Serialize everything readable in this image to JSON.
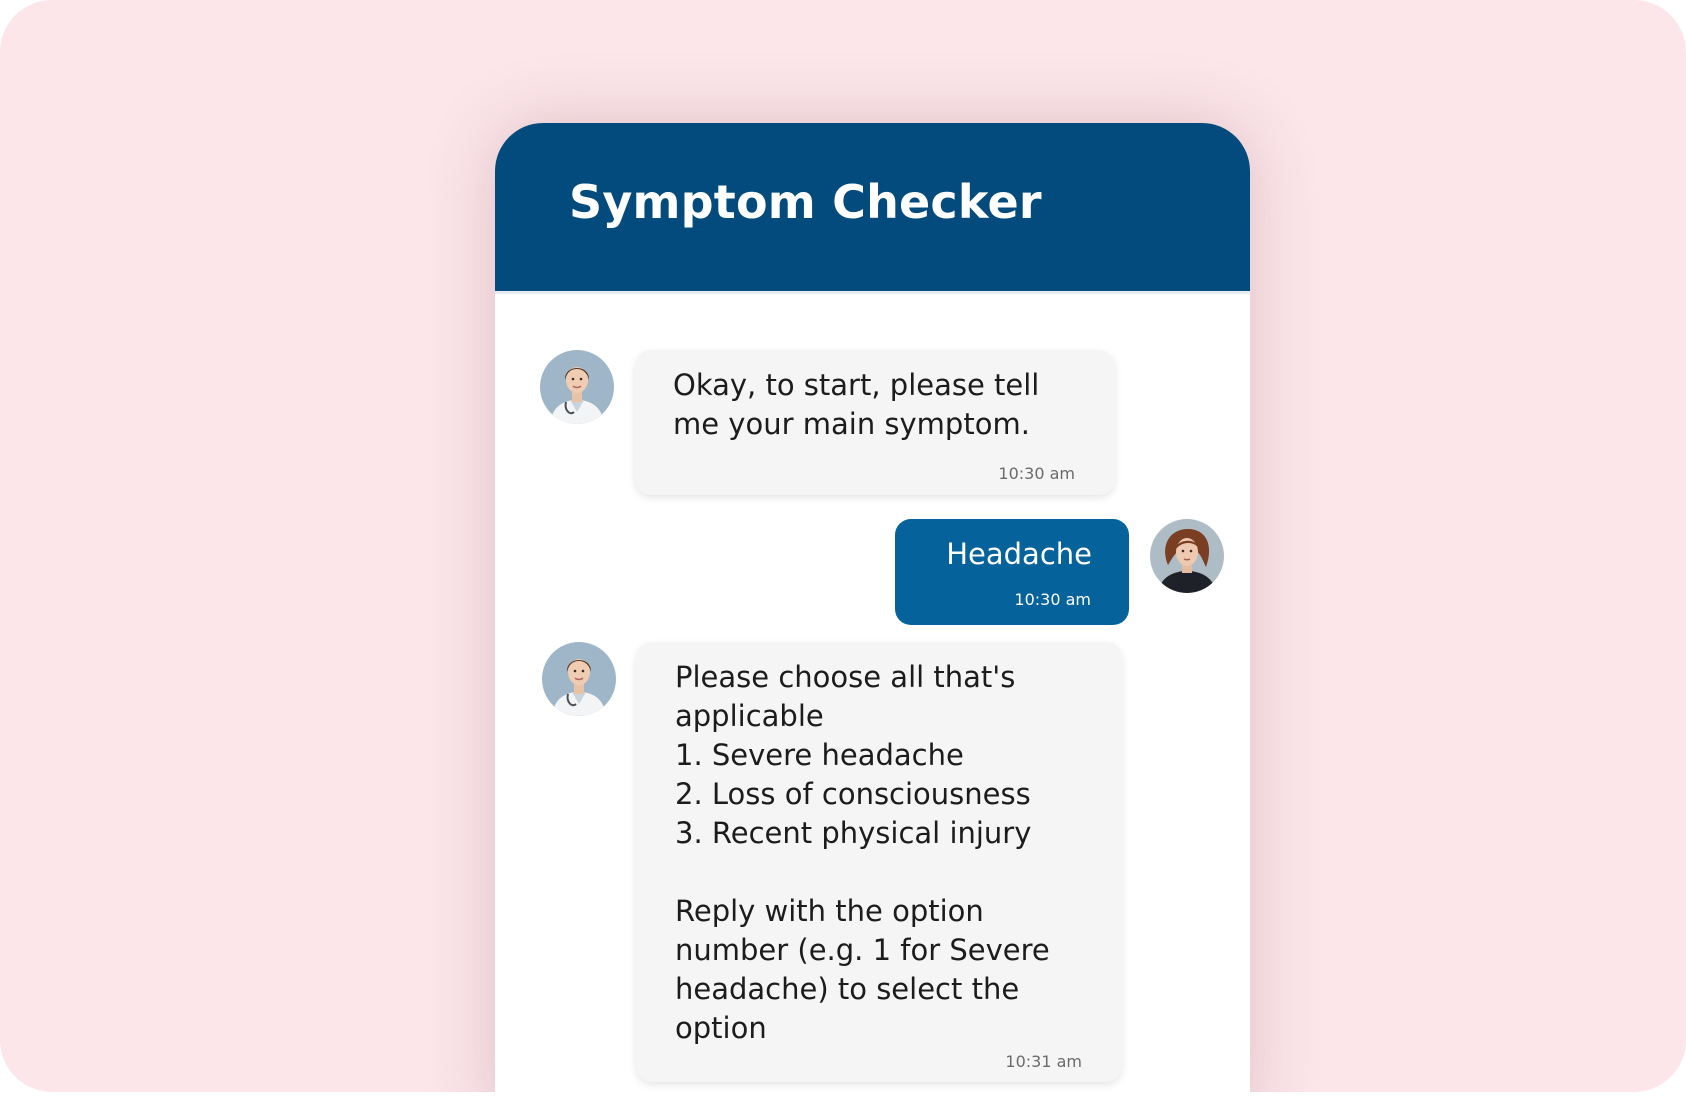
{
  "header": {
    "title": "Symptom Checker"
  },
  "messages": [
    {
      "sender": "bot",
      "text": "Okay, to start, please tell\nme your main symptom.",
      "time": "10:30 am",
      "avatar_icon": "doctor-avatar-icon"
    },
    {
      "sender": "user",
      "text": "Headache",
      "time": "10:30 am",
      "avatar_icon": "user-avatar-icon"
    },
    {
      "sender": "bot",
      "text": "Please choose all that's\napplicable\n1. Severe headache\n2. Loss of consciousness\n3. Recent physical injury\n\nReply with the option\nnumber (e.g. 1 for Severe\nheadache) to select the\noption",
      "time": "10:31 am",
      "avatar_icon": "doctor-avatar-icon"
    }
  ],
  "colors": {
    "background": "#fce6ea",
    "header": "#034b7c",
    "user_bubble": "#05629b",
    "bot_bubble": "#f5f5f5"
  }
}
